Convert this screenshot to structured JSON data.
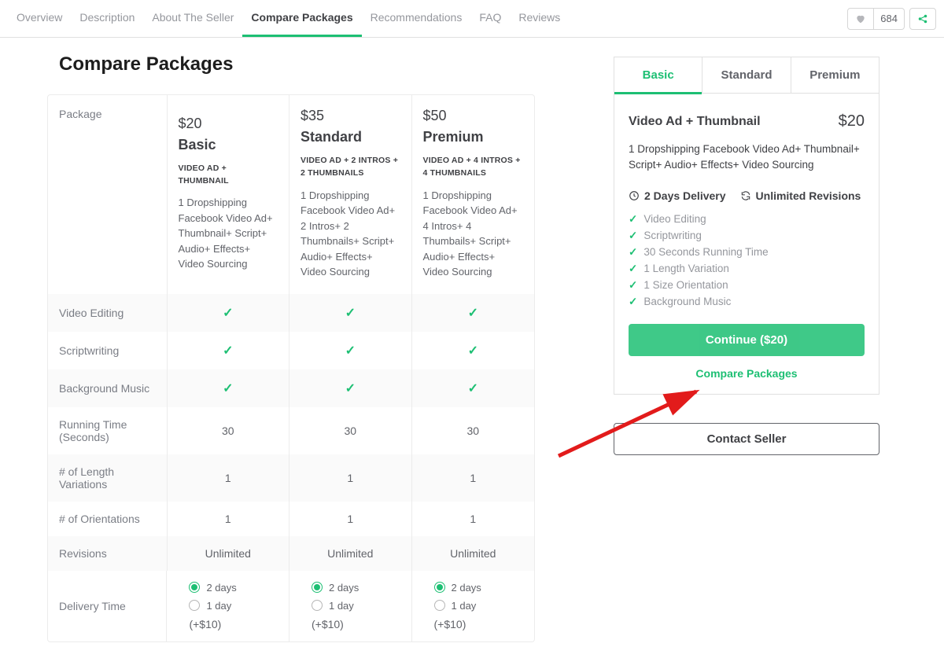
{
  "topnav": {
    "tabs": [
      {
        "label": "Overview",
        "active": false
      },
      {
        "label": "Description",
        "active": false
      },
      {
        "label": "About The Seller",
        "active": false
      },
      {
        "label": "Compare Packages",
        "active": true
      },
      {
        "label": "Recommendations",
        "active": false
      },
      {
        "label": "FAQ",
        "active": false
      },
      {
        "label": "Reviews",
        "active": false
      }
    ],
    "like_count": "684"
  },
  "page_title": "Compare Packages",
  "compare": {
    "header_labels": {
      "package": "Package"
    },
    "packages": [
      {
        "price": "$20",
        "name": "Basic",
        "sub": "VIDEO AD + THUMBNAIL",
        "desc": "1 Dropshipping Facebook Video Ad+ Thumbnail+ Script+ Audio+ Effects+ Video Sourcing"
      },
      {
        "price": "$35",
        "name": "Standard",
        "sub": "VIDEO AD + 2 INTROS + 2 THUMBNAILS",
        "desc": "1 Dropshipping Facebook Video Ad+ 2 Intros+ 2 Thumbnails+ Script+ Audio+ Effects+ Video Sourcing"
      },
      {
        "price": "$50",
        "name": "Premium",
        "sub": "VIDEO AD + 4 INTROS + 4 THUMBNAILS",
        "desc": "1 Dropshipping Facebook Video Ad+ 4 Intros+ 4 Thumbails+ Script+ Audio+ Effects+ Video Sourcing"
      }
    ],
    "rows": [
      {
        "label": "Video Editing",
        "vals": [
          "✓",
          "✓",
          "✓"
        ],
        "type": "check"
      },
      {
        "label": "Scriptwriting",
        "vals": [
          "✓",
          "✓",
          "✓"
        ],
        "type": "check"
      },
      {
        "label": "Background Music",
        "vals": [
          "✓",
          "✓",
          "✓"
        ],
        "type": "check"
      },
      {
        "label": "Running Time (Seconds)",
        "vals": [
          "30",
          "30",
          "30"
        ],
        "type": "text"
      },
      {
        "label": "# of Length Variations",
        "vals": [
          "1",
          "1",
          "1"
        ],
        "type": "text"
      },
      {
        "label": "# of Orientations",
        "vals": [
          "1",
          "1",
          "1"
        ],
        "type": "text"
      },
      {
        "label": "Revisions",
        "vals": [
          "Unlimited",
          "Unlimited",
          "Unlimited"
        ],
        "type": "text"
      },
      {
        "label": "Delivery Time",
        "type": "radio"
      }
    ],
    "delivery_options": [
      {
        "label": "2 days",
        "selected": true,
        "extra": ""
      },
      {
        "label": "1 day",
        "selected": false,
        "extra": "(+$10)"
      }
    ]
  },
  "sidebar": {
    "tabs": [
      {
        "label": "Basic",
        "active": true
      },
      {
        "label": "Standard",
        "active": false
      },
      {
        "label": "Premium",
        "active": false
      }
    ],
    "title": "Video Ad + Thumbnail",
    "price": "$20",
    "desc": "1 Dropshipping Facebook Video Ad+ Thumbnail+ Script+ Audio+ Effects+ Video Sourcing",
    "delivery": "2 Days Delivery",
    "revisions": "Unlimited Revisions",
    "features": [
      "Video Editing",
      "Scriptwriting",
      "30 Seconds Running Time",
      "1 Length Variation",
      "1 Size Orientation",
      "Background Music"
    ],
    "continue_label": "Continue ($20)",
    "compare_link": "Compare Packages",
    "contact_label": "Contact Seller"
  }
}
